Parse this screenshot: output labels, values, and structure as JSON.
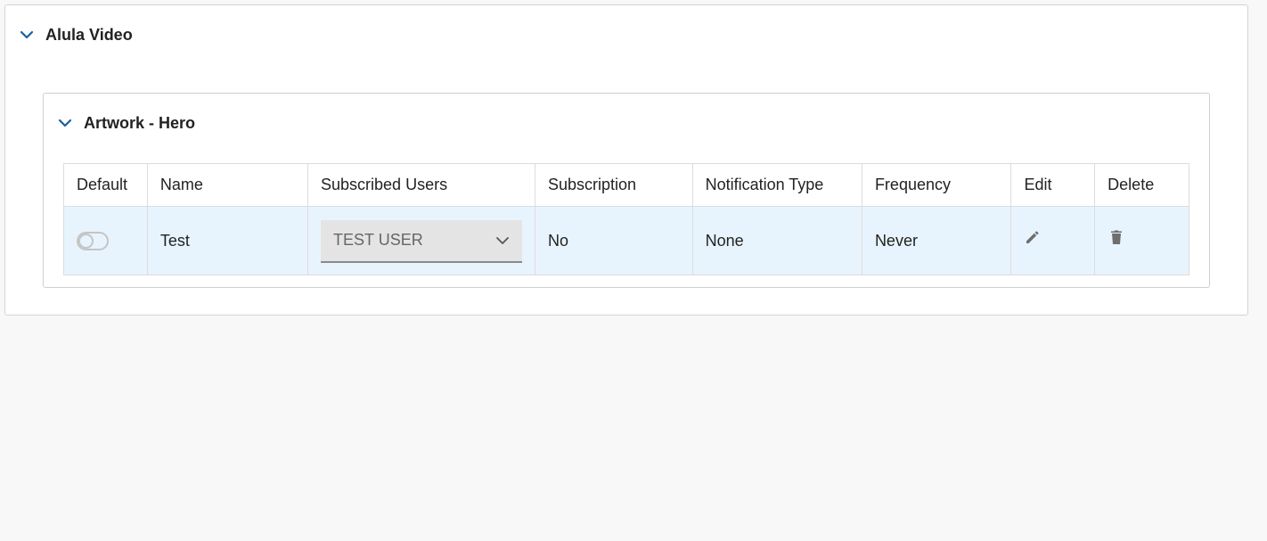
{
  "outer_section": {
    "title": "Alula Video"
  },
  "inner_section": {
    "title": "Artwork - Hero"
  },
  "table": {
    "headers": {
      "default": "Default",
      "name": "Name",
      "subscribed_users": "Subscribed Users",
      "subscription": "Subscription",
      "notification_type": "Notification Type",
      "frequency": "Frequency",
      "edit": "Edit",
      "delete": "Delete"
    },
    "rows": [
      {
        "default_enabled": false,
        "name": "Test",
        "subscribed_users_selected": "TEST USER",
        "subscription": "No",
        "notification_type": "None",
        "frequency": "Never",
        "edit_icon": "pencil-icon",
        "delete_icon": "trash-icon"
      }
    ]
  },
  "colors": {
    "accent": "#1a5f9e",
    "row_highlight": "#e8f4fd",
    "page_background": "#f8f8f8",
    "icon_gray": "#6e6e6e"
  }
}
